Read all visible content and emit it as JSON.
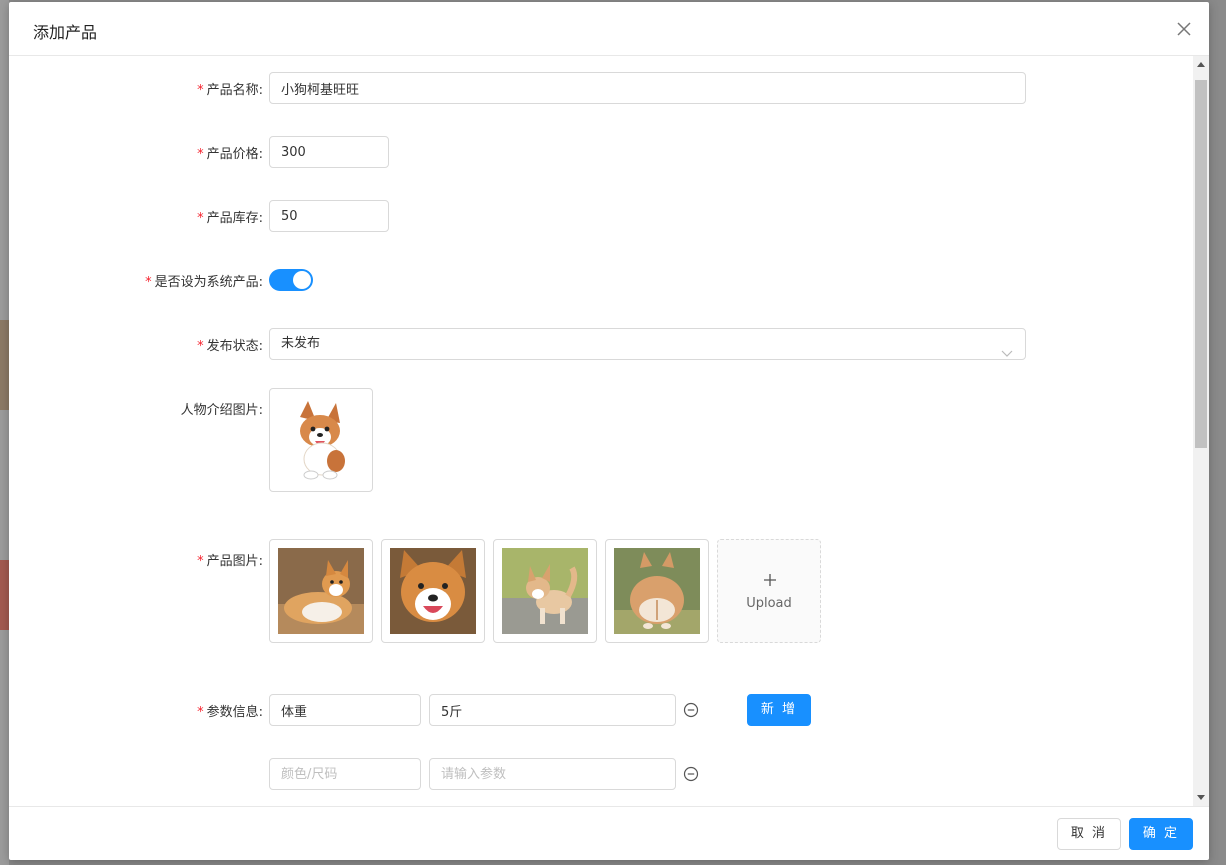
{
  "modal": {
    "title": "添加产品",
    "close_icon": "close-icon"
  },
  "form": {
    "product_name": {
      "label": "产品名称:",
      "required": true,
      "value": "小狗柯基旺旺"
    },
    "product_price": {
      "label": "产品价格:",
      "required": true,
      "value": "300"
    },
    "product_stock": {
      "label": "产品库存:",
      "required": true,
      "value": "50"
    },
    "system_product": {
      "label": "是否设为系统产品:",
      "required": true,
      "checked": true
    },
    "publish_status": {
      "label": "发布状态:",
      "required": true,
      "value": "未发布",
      "icon": "chevron-down-icon"
    },
    "intro_image": {
      "label": "人物介绍图片:",
      "required": false,
      "image": "corgi-cartoon"
    },
    "product_images": {
      "label": "产品图片:",
      "required": true,
      "images": [
        "corgi-lying",
        "corgi-face",
        "corgi-walking",
        "corgi-back"
      ],
      "upload_label": "Upload",
      "upload_icon": "plus-icon"
    },
    "params": {
      "label": "参数信息:",
      "required": true,
      "add_label": "新 增",
      "remove_icon": "minus-circle-icon",
      "rows": [
        {
          "key": "体重",
          "key_placeholder": "颜色/尺码",
          "value": "5斤",
          "value_placeholder": "请输入参数"
        },
        {
          "key": "",
          "key_placeholder": "颜色/尺码",
          "value": "",
          "value_placeholder": "请输入参数"
        }
      ]
    }
  },
  "footer": {
    "cancel_label": "取 消",
    "ok_label": "确 定"
  },
  "colors": {
    "primary": "#1890ff",
    "required_mark": "#f5222d",
    "border": "#d9d9d9"
  }
}
